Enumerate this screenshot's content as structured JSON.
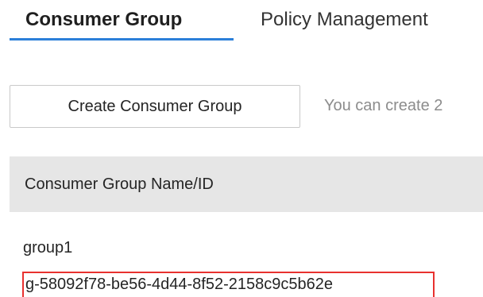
{
  "tabs": [
    {
      "label": "Consumer Group",
      "active": true
    },
    {
      "label": "Policy Management",
      "active": false
    }
  ],
  "toolbar": {
    "create_button_label": "Create Consumer Group",
    "quota_text": "You can create 2"
  },
  "table": {
    "columns": [
      "Consumer Group Name/ID"
    ],
    "rows": [
      {
        "name": "group1",
        "id": "g-58092f78-be56-4d44-8f52-2158c9c5b62e"
      }
    ]
  },
  "colors": {
    "accent": "#2b7fd9",
    "highlight_border": "#e8312f",
    "header_bg": "#e6e6e6",
    "muted_text": "#8c8c8c"
  }
}
